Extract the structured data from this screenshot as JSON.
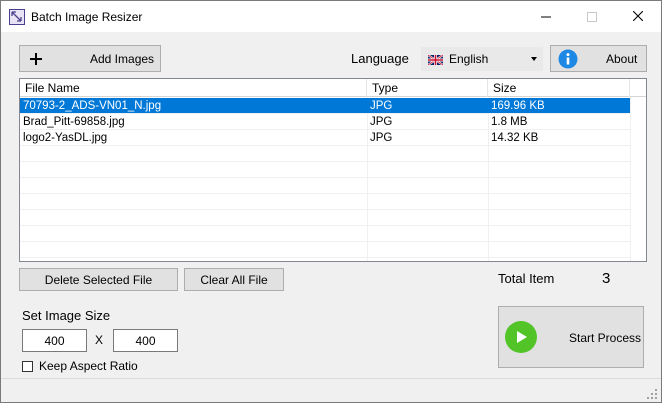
{
  "window": {
    "title": "Batch Image Resizer"
  },
  "toolbar": {
    "add_images_label": "Add Images",
    "language_label": "Language",
    "language_value": "English",
    "about_label": "About"
  },
  "table": {
    "columns": [
      "File Name",
      "Type",
      "Size"
    ],
    "rows": [
      {
        "name": "70793-2_ADS-VN01_N.jpg",
        "type": "JPG",
        "size": "169.96 KB",
        "selected": true
      },
      {
        "name": "Brad_Pitt-69858.jpg",
        "type": "JPG",
        "size": "1.8 MB",
        "selected": false
      },
      {
        "name": "logo2-YasDL.jpg",
        "type": "JPG",
        "size": "14.32 KB",
        "selected": false
      }
    ]
  },
  "actions": {
    "delete_label": "Delete Selected File",
    "clear_label": "Clear All File"
  },
  "total": {
    "label": "Total Item",
    "value": "3"
  },
  "size": {
    "label": "Set Image Size",
    "width": "400",
    "height": "400",
    "separator": "X",
    "keep_ratio_label": "Keep Aspect Ratio",
    "keep_ratio_checked": false
  },
  "start": {
    "label": "Start Process"
  },
  "colors": {
    "accent": "#0078d7",
    "play": "#52c428",
    "info": "#1e88e5"
  },
  "icons": {
    "app": "image-resize-icon",
    "add": "plus-icon",
    "flag": "uk-flag-icon",
    "about": "info-icon",
    "start": "play-icon"
  }
}
